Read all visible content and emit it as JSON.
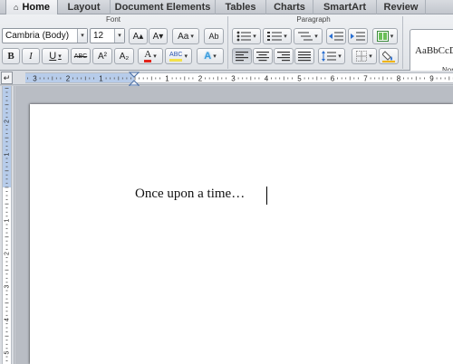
{
  "tabs": [
    {
      "label": "Home",
      "active": true
    },
    {
      "label": "Layout"
    },
    {
      "label": "Document Elements"
    },
    {
      "label": "Tables"
    },
    {
      "label": "Charts"
    },
    {
      "label": "SmartArt"
    },
    {
      "label": "Review"
    }
  ],
  "ribbon": {
    "font_group_title": "Font",
    "paragraph_group_title": "Paragraph",
    "font_name": "Cambria (Body)",
    "font_size": "12",
    "style_sample": "AaBbCcDdE",
    "style_name": "Normal"
  },
  "icons": {
    "home": "⌂",
    "drop": "▾",
    "bold": "B",
    "italic": "I",
    "underline": "U",
    "strike": "ABC",
    "super": "A²",
    "sub": "A₂",
    "font_color": "A",
    "highlight": "ABC",
    "text_effects": "A",
    "grow": "A▴",
    "shrink": "A▾",
    "change_case": "Aa",
    "clear_format": "Ab",
    "tab_selector": "↵"
  },
  "colors": {
    "font_color_underline": "#e2231a",
    "highlight_underline": "#f4e14a",
    "text_effects": "#3a9bdc"
  },
  "ruler": {
    "labels": [
      "3",
      "2",
      "1",
      "1",
      "2",
      "3",
      "4",
      "5",
      "6",
      "7",
      "8",
      "9"
    ]
  },
  "vruler": {
    "labels": [
      "2",
      "1",
      "1",
      "2",
      "3",
      "4",
      "5"
    ]
  },
  "document": {
    "text": "Once upon a time…"
  }
}
